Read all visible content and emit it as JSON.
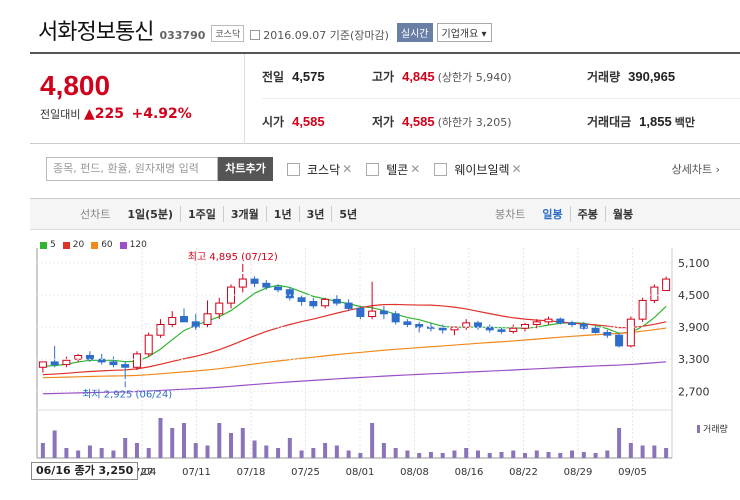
{
  "header": {
    "name": "서화정보통신",
    "code": "033790",
    "market_badge": "코스닥",
    "date": "2016.09.07",
    "date_basis": "기준(장마감)",
    "realtime_label": "실시간",
    "company_label": "기업개요"
  },
  "price": {
    "current": "4,800",
    "change_label": "전일대비",
    "change": "225",
    "change_pct": "+4.92%"
  },
  "stats": {
    "prev_close_label": "전일",
    "prev_close": "4,575",
    "high_label": "고가",
    "high": "4,845",
    "high_sub": "(상한가 5,940)",
    "volume_label": "거래량",
    "volume": "390,965",
    "open_label": "시가",
    "open": "4,585",
    "low_label": "저가",
    "low": "4,585",
    "low_sub": "(하한가 3,205)",
    "amount_label": "거래대금",
    "amount": "1,855",
    "amount_unit": "백만"
  },
  "compare": {
    "placeholder": "종목, 펀드, 환율, 원자재명 입력",
    "add_button": "차트추가",
    "options": [
      "코스닥",
      "텔콘",
      "웨이브일렉"
    ],
    "detail_link": "상세차트"
  },
  "tabs": {
    "line_head": "선차트",
    "line_tabs": [
      "1일(5분)",
      "1주일",
      "3개월",
      "1년",
      "3년",
      "5년"
    ],
    "candle_head": "봉차트",
    "candle_tabs": [
      "일봉",
      "주봉",
      "월봉"
    ],
    "candle_active": "일봉"
  },
  "legend": [
    {
      "label": "5",
      "color": "#2fb52f"
    },
    {
      "label": "20",
      "color": "#e0302a"
    },
    {
      "label": "60",
      "color": "#f08a1c"
    },
    {
      "label": "120",
      "color": "#9b4fc8"
    }
  ],
  "chart_annotations": {
    "high_label": "최고",
    "high_value": "4,895",
    "high_date": "(07/12)",
    "low_label": "최저",
    "low_value": "2,925",
    "low_date": "(06/24)",
    "volume_label": "거래량",
    "cursor_label": "06/16 종가 3,250"
  },
  "chart_data": {
    "type": "candlestick",
    "y_ticks": [
      5100,
      4500,
      3900,
      3300,
      2700
    ],
    "x_labels": [
      "27",
      "07/04",
      "07/11",
      "07/18",
      "07/25",
      "08/01",
      "08/08",
      "08/16",
      "08/22",
      "08/29",
      "09/05"
    ],
    "colors": {
      "up": "#d0021b",
      "down": "#2e6ec9",
      "volume": "#8a73b8"
    },
    "candles": [
      {
        "o": 3150,
        "h": 3250,
        "l": 3050,
        "c": 3250
      },
      {
        "o": 3250,
        "h": 3550,
        "l": 3150,
        "c": 3200
      },
      {
        "o": 3200,
        "h": 3350,
        "l": 3150,
        "c": 3280
      },
      {
        "o": 3300,
        "h": 3400,
        "l": 3250,
        "c": 3370
      },
      {
        "o": 3370,
        "h": 3450,
        "l": 3250,
        "c": 3300
      },
      {
        "o": 3300,
        "h": 3400,
        "l": 3200,
        "c": 3250
      },
      {
        "o": 3250,
        "h": 3350,
        "l": 3150,
        "c": 3200
      },
      {
        "o": 3200,
        "h": 3260,
        "l": 2925,
        "c": 3150
      },
      {
        "o": 3150,
        "h": 3450,
        "l": 3100,
        "c": 3400
      },
      {
        "o": 3400,
        "h": 3800,
        "l": 3350,
        "c": 3750
      },
      {
        "o": 3750,
        "h": 4050,
        "l": 3700,
        "c": 3950
      },
      {
        "o": 3950,
        "h": 4200,
        "l": 3900,
        "c": 4080
      },
      {
        "o": 4100,
        "h": 4250,
        "l": 4000,
        "c": 4000
      },
      {
        "o": 4000,
        "h": 4150,
        "l": 3850,
        "c": 3900
      },
      {
        "o": 3950,
        "h": 4400,
        "l": 3900,
        "c": 4150
      },
      {
        "o": 4150,
        "h": 4450,
        "l": 4050,
        "c": 4350
      },
      {
        "o": 4350,
        "h": 4700,
        "l": 4250,
        "c": 4650
      },
      {
        "o": 4650,
        "h": 4895,
        "l": 4550,
        "c": 4800
      },
      {
        "o": 4800,
        "h": 4850,
        "l": 4650,
        "c": 4720
      },
      {
        "o": 4720,
        "h": 4780,
        "l": 4600,
        "c": 4650
      },
      {
        "o": 4650,
        "h": 4700,
        "l": 4550,
        "c": 4600
      },
      {
        "o": 4600,
        "h": 4650,
        "l": 4400,
        "c": 4450
      },
      {
        "o": 4450,
        "h": 4500,
        "l": 4300,
        "c": 4380
      },
      {
        "o": 4380,
        "h": 4450,
        "l": 4250,
        "c": 4300
      },
      {
        "o": 4300,
        "h": 4450,
        "l": 4250,
        "c": 4420
      },
      {
        "o": 4420,
        "h": 4500,
        "l": 4300,
        "c": 4350
      },
      {
        "o": 4350,
        "h": 4420,
        "l": 4200,
        "c": 4250
      },
      {
        "o": 4250,
        "h": 4300,
        "l": 4050,
        "c": 4100
      },
      {
        "o": 4100,
        "h": 4750,
        "l": 4050,
        "c": 4200
      },
      {
        "o": 4200,
        "h": 4300,
        "l": 4050,
        "c": 4150
      },
      {
        "o": 4150,
        "h": 4200,
        "l": 3950,
        "c": 4000
      },
      {
        "o": 4000,
        "h": 4050,
        "l": 3900,
        "c": 3950
      },
      {
        "o": 3950,
        "h": 4000,
        "l": 3800,
        "c": 3900
      },
      {
        "o": 3900,
        "h": 3980,
        "l": 3820,
        "c": 3880
      },
      {
        "o": 3880,
        "h": 3950,
        "l": 3780,
        "c": 3850
      },
      {
        "o": 3850,
        "h": 3920,
        "l": 3750,
        "c": 3900
      },
      {
        "o": 3900,
        "h": 4050,
        "l": 3850,
        "c": 3980
      },
      {
        "o": 3980,
        "h": 4020,
        "l": 3850,
        "c": 3900
      },
      {
        "o": 3900,
        "h": 3950,
        "l": 3800,
        "c": 3850
      },
      {
        "o": 3850,
        "h": 3900,
        "l": 3780,
        "c": 3820
      },
      {
        "o": 3820,
        "h": 3950,
        "l": 3780,
        "c": 3880
      },
      {
        "o": 3880,
        "h": 3980,
        "l": 3820,
        "c": 3950
      },
      {
        "o": 3950,
        "h": 4050,
        "l": 3880,
        "c": 4000
      },
      {
        "o": 4000,
        "h": 4100,
        "l": 3950,
        "c": 4050
      },
      {
        "o": 4050,
        "h": 4080,
        "l": 3950,
        "c": 3980
      },
      {
        "o": 3980,
        "h": 4020,
        "l": 3900,
        "c": 3950
      },
      {
        "o": 3950,
        "h": 4000,
        "l": 3850,
        "c": 3880
      },
      {
        "o": 3880,
        "h": 3920,
        "l": 3780,
        "c": 3800
      },
      {
        "o": 3800,
        "h": 3850,
        "l": 3700,
        "c": 3750
      },
      {
        "o": 3750,
        "h": 3800,
        "l": 3520,
        "c": 3550
      },
      {
        "o": 3550,
        "h": 4100,
        "l": 3520,
        "c": 4050
      },
      {
        "o": 4050,
        "h": 4450,
        "l": 4000,
        "c": 4400
      },
      {
        "o": 4400,
        "h": 4700,
        "l": 4350,
        "c": 4650
      },
      {
        "o": 4585,
        "h": 4845,
        "l": 4585,
        "c": 4800
      }
    ],
    "volume": [
      30,
      55,
      20,
      15,
      25,
      20,
      15,
      40,
      30,
      20,
      80,
      60,
      70,
      30,
      25,
      70,
      50,
      60,
      35,
      25,
      20,
      40,
      15,
      20,
      30,
      25,
      15,
      10,
      70,
      30,
      20,
      15,
      10,
      12,
      10,
      15,
      20,
      15,
      10,
      12,
      15,
      10,
      15,
      12,
      10,
      15,
      12,
      10,
      15,
      60,
      30,
      25,
      25,
      20
    ]
  }
}
